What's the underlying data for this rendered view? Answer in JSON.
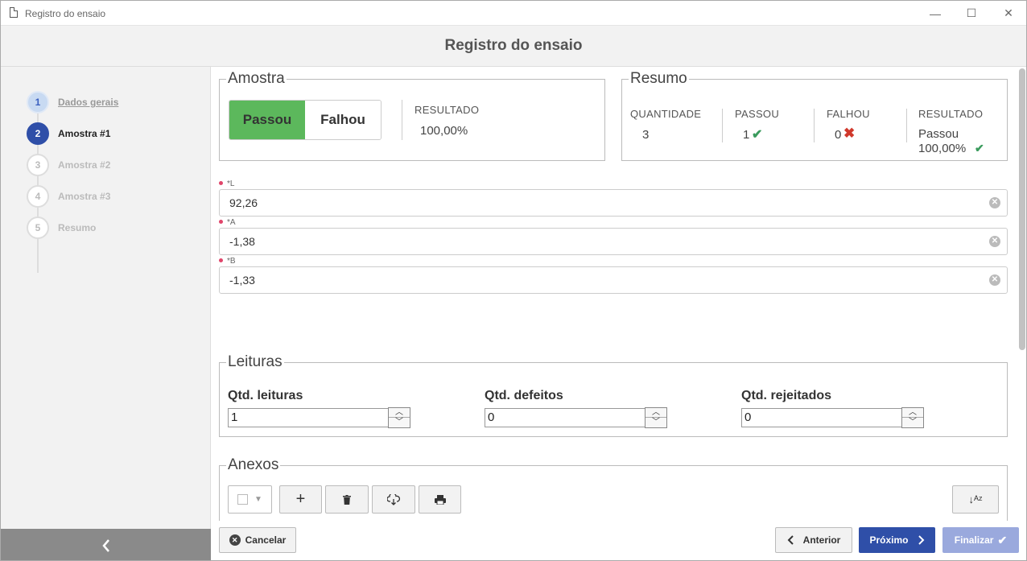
{
  "window": {
    "title": "Registro do ensaio",
    "min": "—",
    "max": "☐",
    "close": "✕"
  },
  "header": {
    "title": "Registro do ensaio"
  },
  "steps": [
    {
      "num": "1",
      "label": "Dados gerais"
    },
    {
      "num": "2",
      "label": "Amostra #1"
    },
    {
      "num": "3",
      "label": "Amostra #2"
    },
    {
      "num": "4",
      "label": "Amostra #3"
    },
    {
      "num": "5",
      "label": "Resumo"
    }
  ],
  "amostra": {
    "legend": "Amostra",
    "pass_label": "Passou",
    "fail_label": "Falhou",
    "result_caption": "RESULTADO",
    "result_value": "100,00%"
  },
  "resumo": {
    "legend": "Resumo",
    "qty_caption": "QUANTIDADE",
    "qty_value": "3",
    "pass_caption": "PASSOU",
    "pass_value": "1",
    "fail_caption": "FALHOU",
    "fail_value": "0",
    "result_caption": "RESULTADO",
    "result_status": "Passou",
    "result_pct": "100,00%"
  },
  "fields": [
    {
      "label": "*L",
      "value": "92,26"
    },
    {
      "label": "*A",
      "value": "-1,38"
    },
    {
      "label": "*B",
      "value": "-1,33"
    }
  ],
  "leituras": {
    "legend": "Leituras",
    "qtd_leituras_label": "Qtd. leituras",
    "qtd_leituras": "1",
    "qtd_defeitos_label": "Qtd. defeitos",
    "qtd_defeitos": "0",
    "qtd_rejeitados_label": "Qtd. rejeitados",
    "qtd_rejeitados": "0"
  },
  "anexos": {
    "legend": "Anexos",
    "add": "+",
    "sort": "↓ᴬᶻ"
  },
  "footer": {
    "cancel": "Cancelar",
    "prev": "Anterior",
    "next": "Próximo",
    "finish": "Finalizar"
  },
  "colors": {
    "accent": "#2f4fa8",
    "pass": "#5cb85c",
    "check": "#3a9b5d",
    "cross": "#d0382b"
  },
  "icons": {
    "prev": "chevron-left-icon",
    "next": "chevron-right-icon",
    "finish": "check-icon",
    "cancel": "close-circle-icon"
  }
}
